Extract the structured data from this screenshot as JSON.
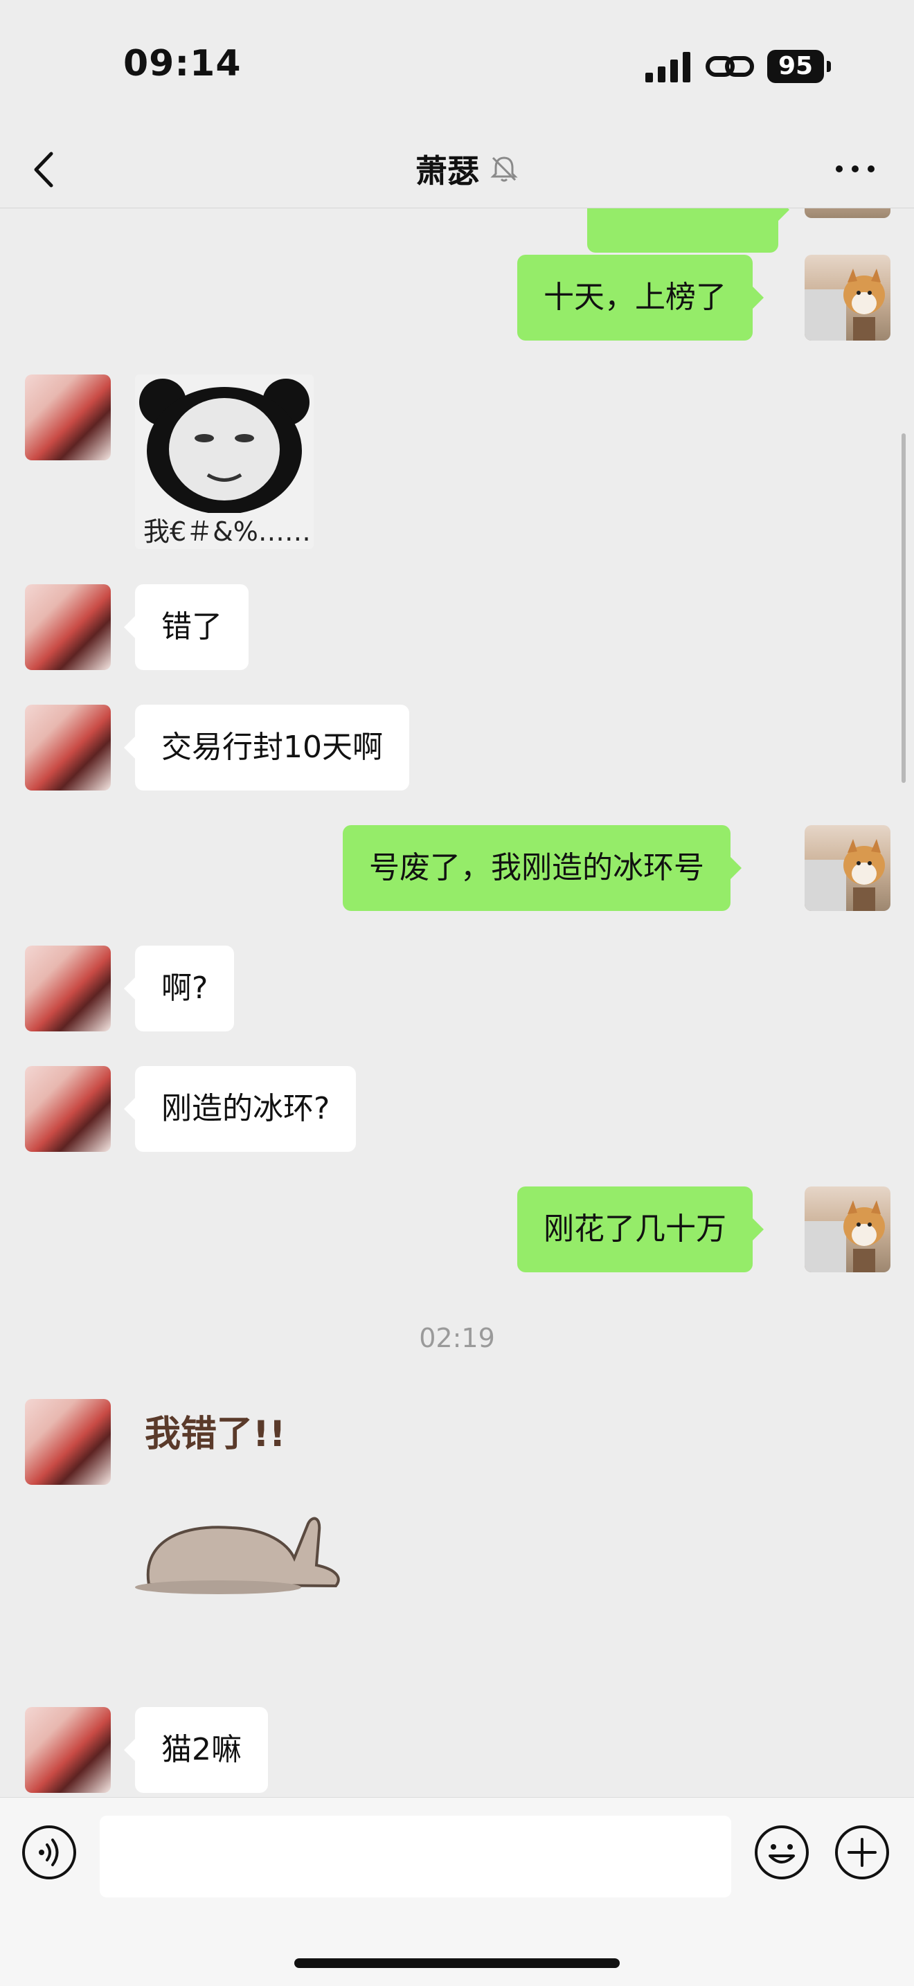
{
  "status": {
    "time": "09:14",
    "battery": "95"
  },
  "nav": {
    "title": "萧瑟",
    "icons": [
      "back-icon",
      "mute-icon",
      "more-icon"
    ]
  },
  "messages": [
    {
      "side": "out",
      "text": "十天，上榜了"
    },
    {
      "side": "in",
      "sticker": "panda-face",
      "caption": "我€＃&%……"
    },
    {
      "side": "in",
      "text": "错了"
    },
    {
      "side": "in",
      "text": "交易行封10天啊"
    },
    {
      "side": "out",
      "text": "号废了，我刚造的冰环号"
    },
    {
      "side": "in",
      "text": "啊?"
    },
    {
      "side": "in",
      "text": "刚造的冰环?"
    },
    {
      "side": "out",
      "text": "刚花了几十万"
    },
    {
      "timestamp": "02:19"
    },
    {
      "side": "in",
      "sticker": "lying-cat",
      "caption": "我错了!!"
    },
    {
      "side": "in",
      "text": "猫2嘛"
    }
  ],
  "input": {
    "placeholder": ""
  },
  "colors": {
    "outgoing_bubble": "#95ec69",
    "incoming_bubble": "#ffffff",
    "background": "#ededed"
  }
}
